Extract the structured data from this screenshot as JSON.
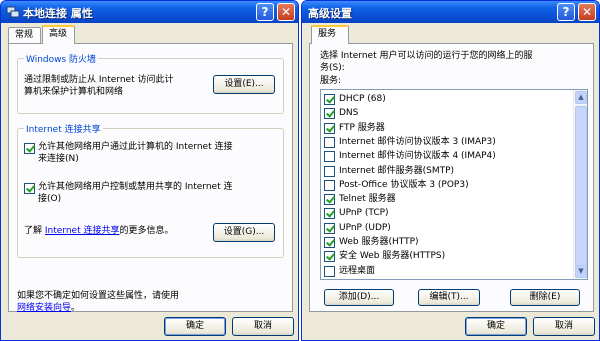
{
  "left_dialog": {
    "title": "本地连接 属性",
    "help_glyph": "?",
    "close_glyph": "✕",
    "tabs": [
      "常规",
      "高级"
    ],
    "firewall": {
      "title": "Windows 防火墙",
      "text_line1": "通过限制或防止从 Internet 访问此计",
      "text_line2": "算机来保护计算机和网络",
      "settings_button": "设置(E)..."
    },
    "ics": {
      "title": "Internet 连接共享",
      "option1_line1": "允许其他网络用户通过此计算机的 Internet 连接",
      "option1_line2": "来连接(N)",
      "option1_checked": true,
      "option2_line1": "允许其他网络用户控制或禁用共享的 Internet 连",
      "option2_line2": "接(O)",
      "option2_checked": true,
      "learn_prefix": "了解",
      "learn_link": "Internet 连接共享",
      "learn_suffix": "的更多信息。",
      "settings_button": "设置(G)..."
    },
    "footer_text": "如果您不确定如何设置这些属性，请使用",
    "footer_link": "网络安装向导",
    "footer_link_suffix": "。",
    "ok_button": "确定",
    "cancel_button": "取消"
  },
  "right_dialog": {
    "title": "高级设置",
    "help_glyph": "?",
    "close_glyph": "✕",
    "tab": "服务",
    "intro_line1": "选择 Internet 用户可以访问的运行于您的网络上的服",
    "intro_line2": "务(S):",
    "services_label": "服务:",
    "services": [
      {
        "label": "DHCP (68)",
        "checked": true
      },
      {
        "label": "DNS",
        "checked": true
      },
      {
        "label": "FTP 服务器",
        "checked": true
      },
      {
        "label": "Internet 邮件访问协议版本 3 (IMAP3)",
        "checked": false
      },
      {
        "label": "Internet 邮件访问协议版本 4 (IMAP4)",
        "checked": false
      },
      {
        "label": "Internet 邮件服务器(SMTP)",
        "checked": false
      },
      {
        "label": "Post-Office 协议版本 3 (POP3)",
        "checked": false
      },
      {
        "label": "Telnet 服务器",
        "checked": true
      },
      {
        "label": "UPnP (TCP)",
        "checked": true
      },
      {
        "label": "UPnP (UDP)",
        "checked": true
      },
      {
        "label": "Web 服务器(HTTP)",
        "checked": true
      },
      {
        "label": "安全 Web 服务器(HTTPS)",
        "checked": true
      },
      {
        "label": "远程桌面",
        "checked": false
      }
    ],
    "add_button": "添加(D)...",
    "edit_button": "编辑(T)...",
    "delete_button": "删除(E)",
    "ok_button": "确定",
    "cancel_button": "取消"
  }
}
